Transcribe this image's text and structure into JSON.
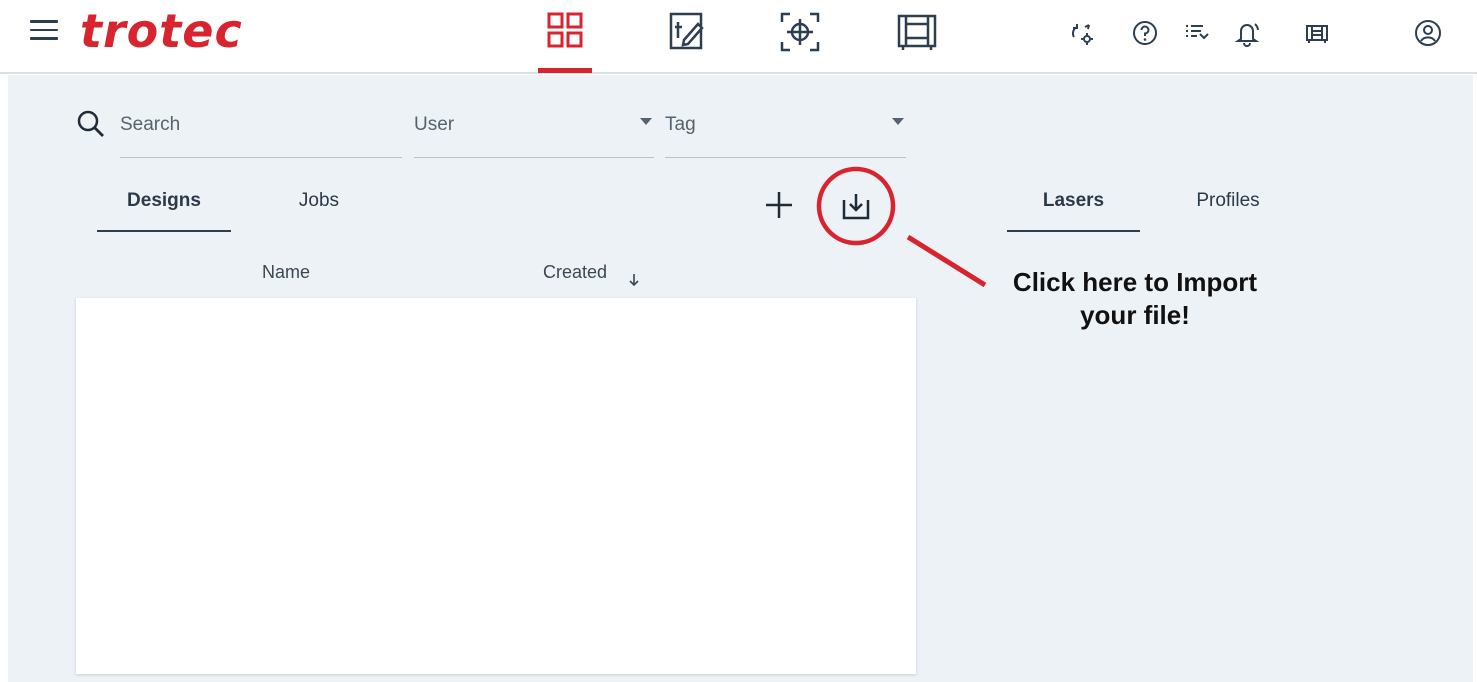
{
  "app": {
    "logo_text": "trotec",
    "brand_color": "#d7242f"
  },
  "nav": {
    "items": [
      {
        "icon": "dashboard-grid-icon",
        "active": true
      },
      {
        "icon": "design-edit-icon",
        "active": false
      },
      {
        "icon": "position-target-icon",
        "active": false
      },
      {
        "icon": "material-frame-icon",
        "active": false
      }
    ]
  },
  "toolbar": {
    "icons": [
      "sync-settings-icon",
      "help-icon",
      "queue-list-icon",
      "notification-bell-icon",
      "laser-machine-icon",
      "user-account-icon"
    ]
  },
  "filters": {
    "search_placeholder": "Search",
    "user_label": "User",
    "tag_label": "Tag"
  },
  "left_tabs": [
    {
      "label": "Designs",
      "active": true
    },
    {
      "label": "Jobs",
      "active": false
    }
  ],
  "actions": {
    "add_icon": "plus-icon",
    "import_icon": "import-file-icon"
  },
  "table": {
    "columns": [
      "Name",
      "Created"
    ],
    "sort": "descending",
    "rows": []
  },
  "right_tabs": [
    {
      "label": "Lasers",
      "active": true
    },
    {
      "label": "Profiles",
      "active": false
    }
  ],
  "annotation": {
    "line1": "Click here to Import",
    "line2": "your file!",
    "color": "#d7242f"
  }
}
